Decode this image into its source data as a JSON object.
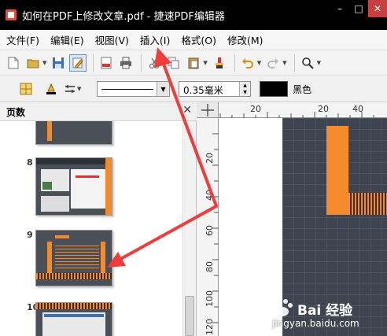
{
  "window": {
    "title": "如何在PDF上修改文章.pdf - 捷速PDF编辑器",
    "controls": [
      "–",
      "□",
      "✕"
    ]
  },
  "menu": {
    "items": [
      "文件(F)",
      "编辑(E)",
      "视图(V)",
      "插入(I)",
      "格式(O)",
      "修改(M)"
    ]
  },
  "toolbar": {
    "icons": [
      "new-file-icon",
      "open-folder-icon",
      "save-icon",
      "edit-icon",
      "export-pdf-icon",
      "print-icon",
      "paste-icon",
      "copy-icon",
      "clipboard-icon",
      "brush-icon",
      "undo-icon",
      "redo-icon",
      "zoom-icon"
    ]
  },
  "format_bar": {
    "line_width_value": "0.35毫米",
    "color_label": "黑色",
    "color_hex": "#000000"
  },
  "panel": {
    "title": "页数",
    "close": "✕",
    "pages": [
      "8",
      "9",
      "10"
    ]
  },
  "ruler": {
    "top": [
      "20",
      "20",
      "40"
    ],
    "left": [
      "20",
      "40",
      "60",
      "80",
      "100",
      "120"
    ]
  },
  "watermark": {
    "logo": "Bai 经验",
    "url": "jingyan.baidu.com"
  },
  "colors": {
    "accent_orange": "#f58a2b",
    "annotation_red": "#ef3d3d",
    "page_dark": "#3f4550"
  }
}
